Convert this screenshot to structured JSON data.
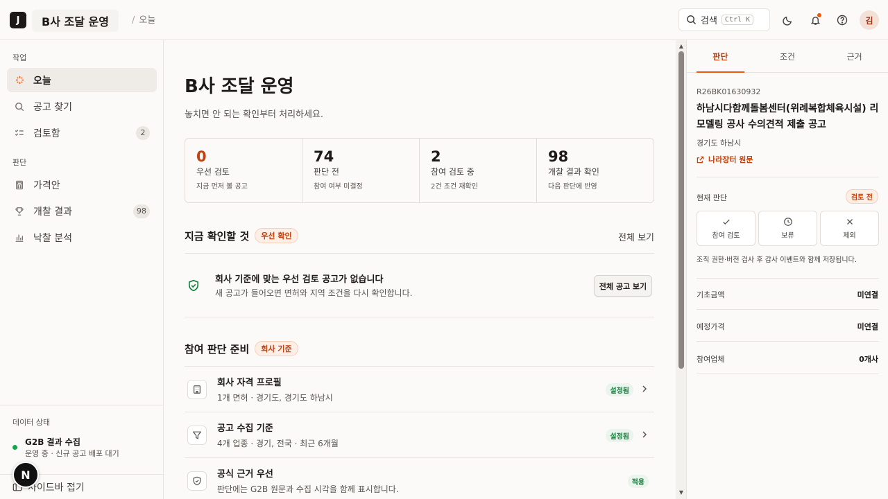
{
  "header": {
    "logo_letter": "J",
    "org_name": "B사 조달 운영",
    "breadcrumb_sep": "/",
    "breadcrumb": "오늘",
    "search_label": "검색",
    "search_shortcut": "Ctrl K",
    "avatar": "김",
    "icons": [
      "search-icon",
      "moon-icon",
      "bell-icon",
      "help-icon"
    ]
  },
  "sidebar": {
    "section_work": "작업",
    "section_judge": "판단",
    "items": [
      {
        "label": "오늘",
        "icon": "sparkle-icon",
        "active": true
      },
      {
        "label": "공고 찾기",
        "icon": "search-icon"
      },
      {
        "label": "검토함",
        "icon": "checklist-icon",
        "count": "2"
      },
      {
        "label": "가격안",
        "icon": "calculator-icon"
      },
      {
        "label": "개찰 결과",
        "icon": "trophy-icon",
        "count": "98"
      },
      {
        "label": "낙찰 분석",
        "icon": "bar-chart-icon"
      }
    ],
    "data_state": {
      "label": "데이터 상태",
      "title": "G2B 결과 수집",
      "subtitle": "운영 중 · 신규 공고 배포 대기"
    },
    "collapse_label": "사이드바 접기",
    "badge_letter": "N"
  },
  "main": {
    "title": "B사 조달 운영",
    "subtitle": "놓치면 안 되는 확인부터 처리하세요.",
    "stats": [
      {
        "value": "0",
        "label": "우선 검토",
        "sub": "지금 먼저 볼 공고",
        "accent": true
      },
      {
        "value": "74",
        "label": "판단 전",
        "sub": "참여 여부 미결정"
      },
      {
        "value": "2",
        "label": "참여 검토 중",
        "sub": "2건 조건 재확인"
      },
      {
        "value": "98",
        "label": "개찰 결과 확인",
        "sub": "다음 판단에 반영"
      }
    ],
    "now_section": {
      "title": "지금 확인할 것",
      "pill": "우선 확인",
      "see_all": "전체 보기",
      "empty_title": "회사 기준에 맞는 우선 검토 공고가 없습니다",
      "empty_sub": "새 공고가 들어오면 면허와 지역 조건을 다시 확인합니다.",
      "button": "전체 공고 보기"
    },
    "prep_section": {
      "title": "참여 판단 준비",
      "pill": "회사 기준",
      "rows": [
        {
          "title": "회사 자격 프로필",
          "sub": "1개 면허 · 경기도, 경기도 하남시",
          "tag": "설정됨",
          "icon": "building-icon"
        },
        {
          "title": "공고 수집 기준",
          "sub": "4개 업종 · 경기, 전국 · 최근 6개월",
          "tag": "설정됨",
          "icon": "filter-icon"
        },
        {
          "title": "공식 근거 우선",
          "sub": "판단에는 G2B 원문과 수집 시각을 함께 표시합니다.",
          "tag": "적용",
          "icon": "shield-icon"
        }
      ]
    }
  },
  "panel": {
    "tabs": [
      "판단",
      "조건",
      "근거"
    ],
    "code": "R26BK01630932",
    "title": "하남시다함께돌봄센터(위례복합체육시설) 리모델링 공사 수의견적 제출 공고",
    "region": "경기도 하남시",
    "link": "나라장터 원문",
    "current_label": "현재 판단",
    "current_pill": "검토 전",
    "choices": [
      {
        "label": "참여 검토",
        "icon": "check-icon"
      },
      {
        "label": "보류",
        "icon": "clock-icon"
      },
      {
        "label": "제외",
        "icon": "close-icon"
      }
    ],
    "note": "조직 권한·버전 검사 후 감사 이벤트와 함께 저장됩니다.",
    "fields": [
      {
        "label": "기초금액",
        "value": "미연결"
      },
      {
        "label": "예정가격",
        "value": "미연결"
      },
      {
        "label": "참여업체",
        "value": "0개사"
      }
    ]
  },
  "colors": {
    "accent": "#ea580c",
    "ok": "#15803d"
  }
}
